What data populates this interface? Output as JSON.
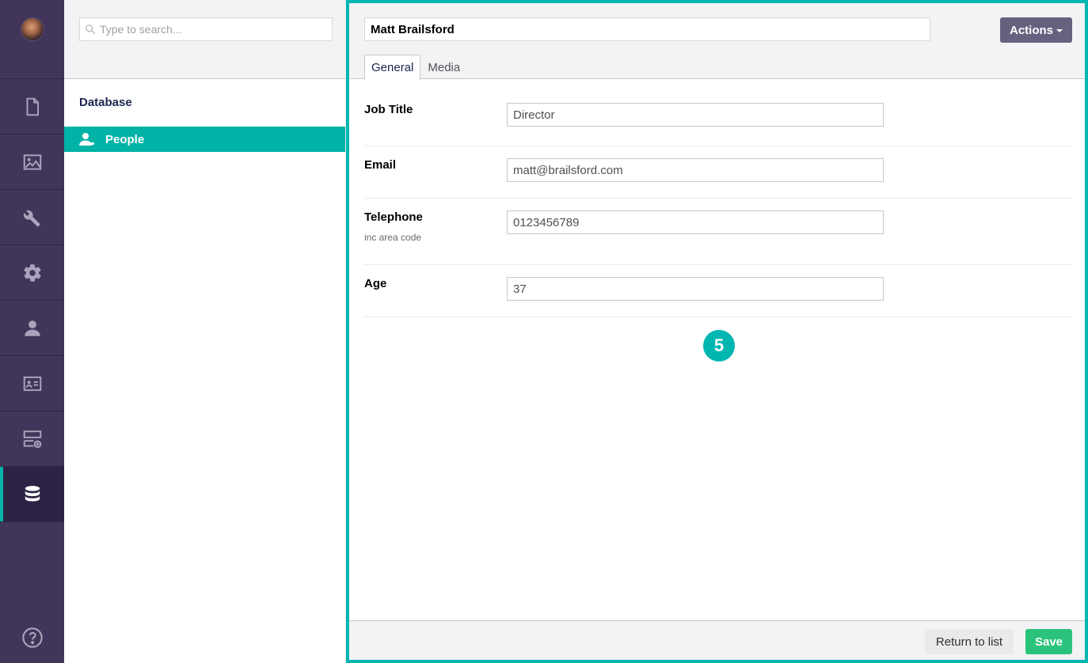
{
  "sidebar": {
    "items": [
      {
        "icon": "document-icon",
        "active": false
      },
      {
        "icon": "image-icon",
        "active": false
      },
      {
        "icon": "wrench-icon",
        "active": false
      },
      {
        "icon": "gear-icon",
        "active": false
      },
      {
        "icon": "user-icon",
        "active": false
      },
      {
        "icon": "id-card-icon",
        "active": false
      },
      {
        "icon": "forms-icon",
        "active": false
      },
      {
        "icon": "database-icon",
        "active": true
      }
    ],
    "help_icon": "help-icon"
  },
  "tree": {
    "search_placeholder": "Type to search...",
    "section_title": "Database",
    "nodes": [
      {
        "label": "People",
        "icon": "person-icon",
        "selected": true
      }
    ]
  },
  "editor": {
    "name_value": "Matt Brailsford",
    "actions_label": "Actions",
    "tabs": [
      {
        "label": "General",
        "active": true
      },
      {
        "label": "Media",
        "active": false
      }
    ],
    "properties": [
      {
        "label": "Job Title",
        "description": "",
        "value": "Director"
      },
      {
        "label": "Email",
        "description": "",
        "value": "matt@brailsford.com"
      },
      {
        "label": "Telephone",
        "description": "inc area code",
        "value": "0123456789"
      },
      {
        "label": "Age",
        "description": "",
        "value": "37"
      }
    ],
    "step_badge": "5",
    "footer": {
      "return_label": "Return to list",
      "save_label": "Save"
    }
  },
  "colors": {
    "sidebar_bg": "#413659",
    "accent": "#00b3a6",
    "highlight_border": "#00b6b1",
    "actions_bg": "#68607f",
    "save_bg": "#2bc37c"
  }
}
